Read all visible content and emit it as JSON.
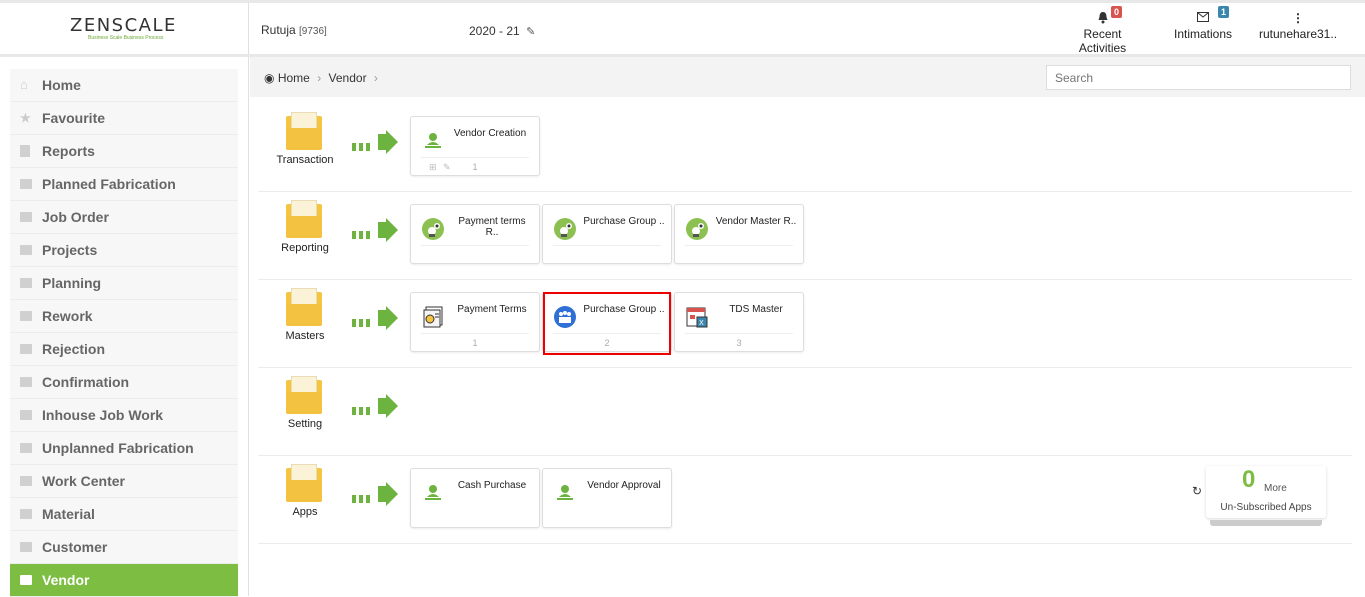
{
  "logo": {
    "brand": "ZENSCALE",
    "tagline": "Business Scale Business Process"
  },
  "header": {
    "user_name": "Rutuja",
    "user_id": "[9736]",
    "fiscal_year": "2020 - 21",
    "recent_activities": {
      "label": "Recent Activities",
      "count": "0"
    },
    "intimations": {
      "label": "Intimations",
      "count": "1"
    },
    "account": {
      "label": "rutunehare31.."
    }
  },
  "sidebar": {
    "items": [
      {
        "label": "Home",
        "icon": "home-icon"
      },
      {
        "label": "Favourite",
        "icon": "star-icon"
      },
      {
        "label": "Reports",
        "icon": "document-icon"
      },
      {
        "label": "Planned Fabrication",
        "icon": "folder-icon"
      },
      {
        "label": "Job Order",
        "icon": "folder-icon"
      },
      {
        "label": "Projects",
        "icon": "folder-icon"
      },
      {
        "label": "Planning",
        "icon": "folder-icon"
      },
      {
        "label": "Rework",
        "icon": "folder-icon"
      },
      {
        "label": "Rejection",
        "icon": "folder-icon"
      },
      {
        "label": "Confirmation",
        "icon": "folder-icon"
      },
      {
        "label": "Inhouse Job Work",
        "icon": "folder-icon"
      },
      {
        "label": "Unplanned Fabrication",
        "icon": "folder-icon"
      },
      {
        "label": "Work Center",
        "icon": "folder-icon"
      },
      {
        "label": "Material",
        "icon": "folder-icon"
      },
      {
        "label": "Customer",
        "icon": "folder-icon"
      },
      {
        "label": "Vendor",
        "icon": "folder-icon",
        "active": true
      }
    ]
  },
  "breadcrumb": {
    "home": "Home",
    "current": "Vendor"
  },
  "search": {
    "placeholder": "Search"
  },
  "rows": {
    "transaction": {
      "label": "Transaction",
      "cards": [
        {
          "title": "Vendor Creation",
          "number": "1"
        }
      ]
    },
    "reporting": {
      "label": "Reporting",
      "cards": [
        {
          "title": "Payment terms R.."
        },
        {
          "title": "Purchase Group .."
        },
        {
          "title": "Vendor Master R.."
        }
      ]
    },
    "masters": {
      "label": "Masters",
      "cards": [
        {
          "title": "Payment Terms",
          "number": "1"
        },
        {
          "title": "Purchase Group ..",
          "number": "2"
        },
        {
          "title": "TDS Master",
          "number": "3"
        }
      ]
    },
    "setting": {
      "label": "Setting"
    },
    "apps": {
      "label": "Apps",
      "cards": [
        {
          "title": "Cash Purchase"
        },
        {
          "title": "Vendor Approval"
        }
      ]
    }
  },
  "unsubscribed": {
    "count": "0",
    "more": "More",
    "label": "Un-Subscribed Apps"
  },
  "colors": {
    "accent_green": "#7dbd42",
    "highlight_red": "#e00000",
    "folder_yellow": "#f5c542"
  }
}
